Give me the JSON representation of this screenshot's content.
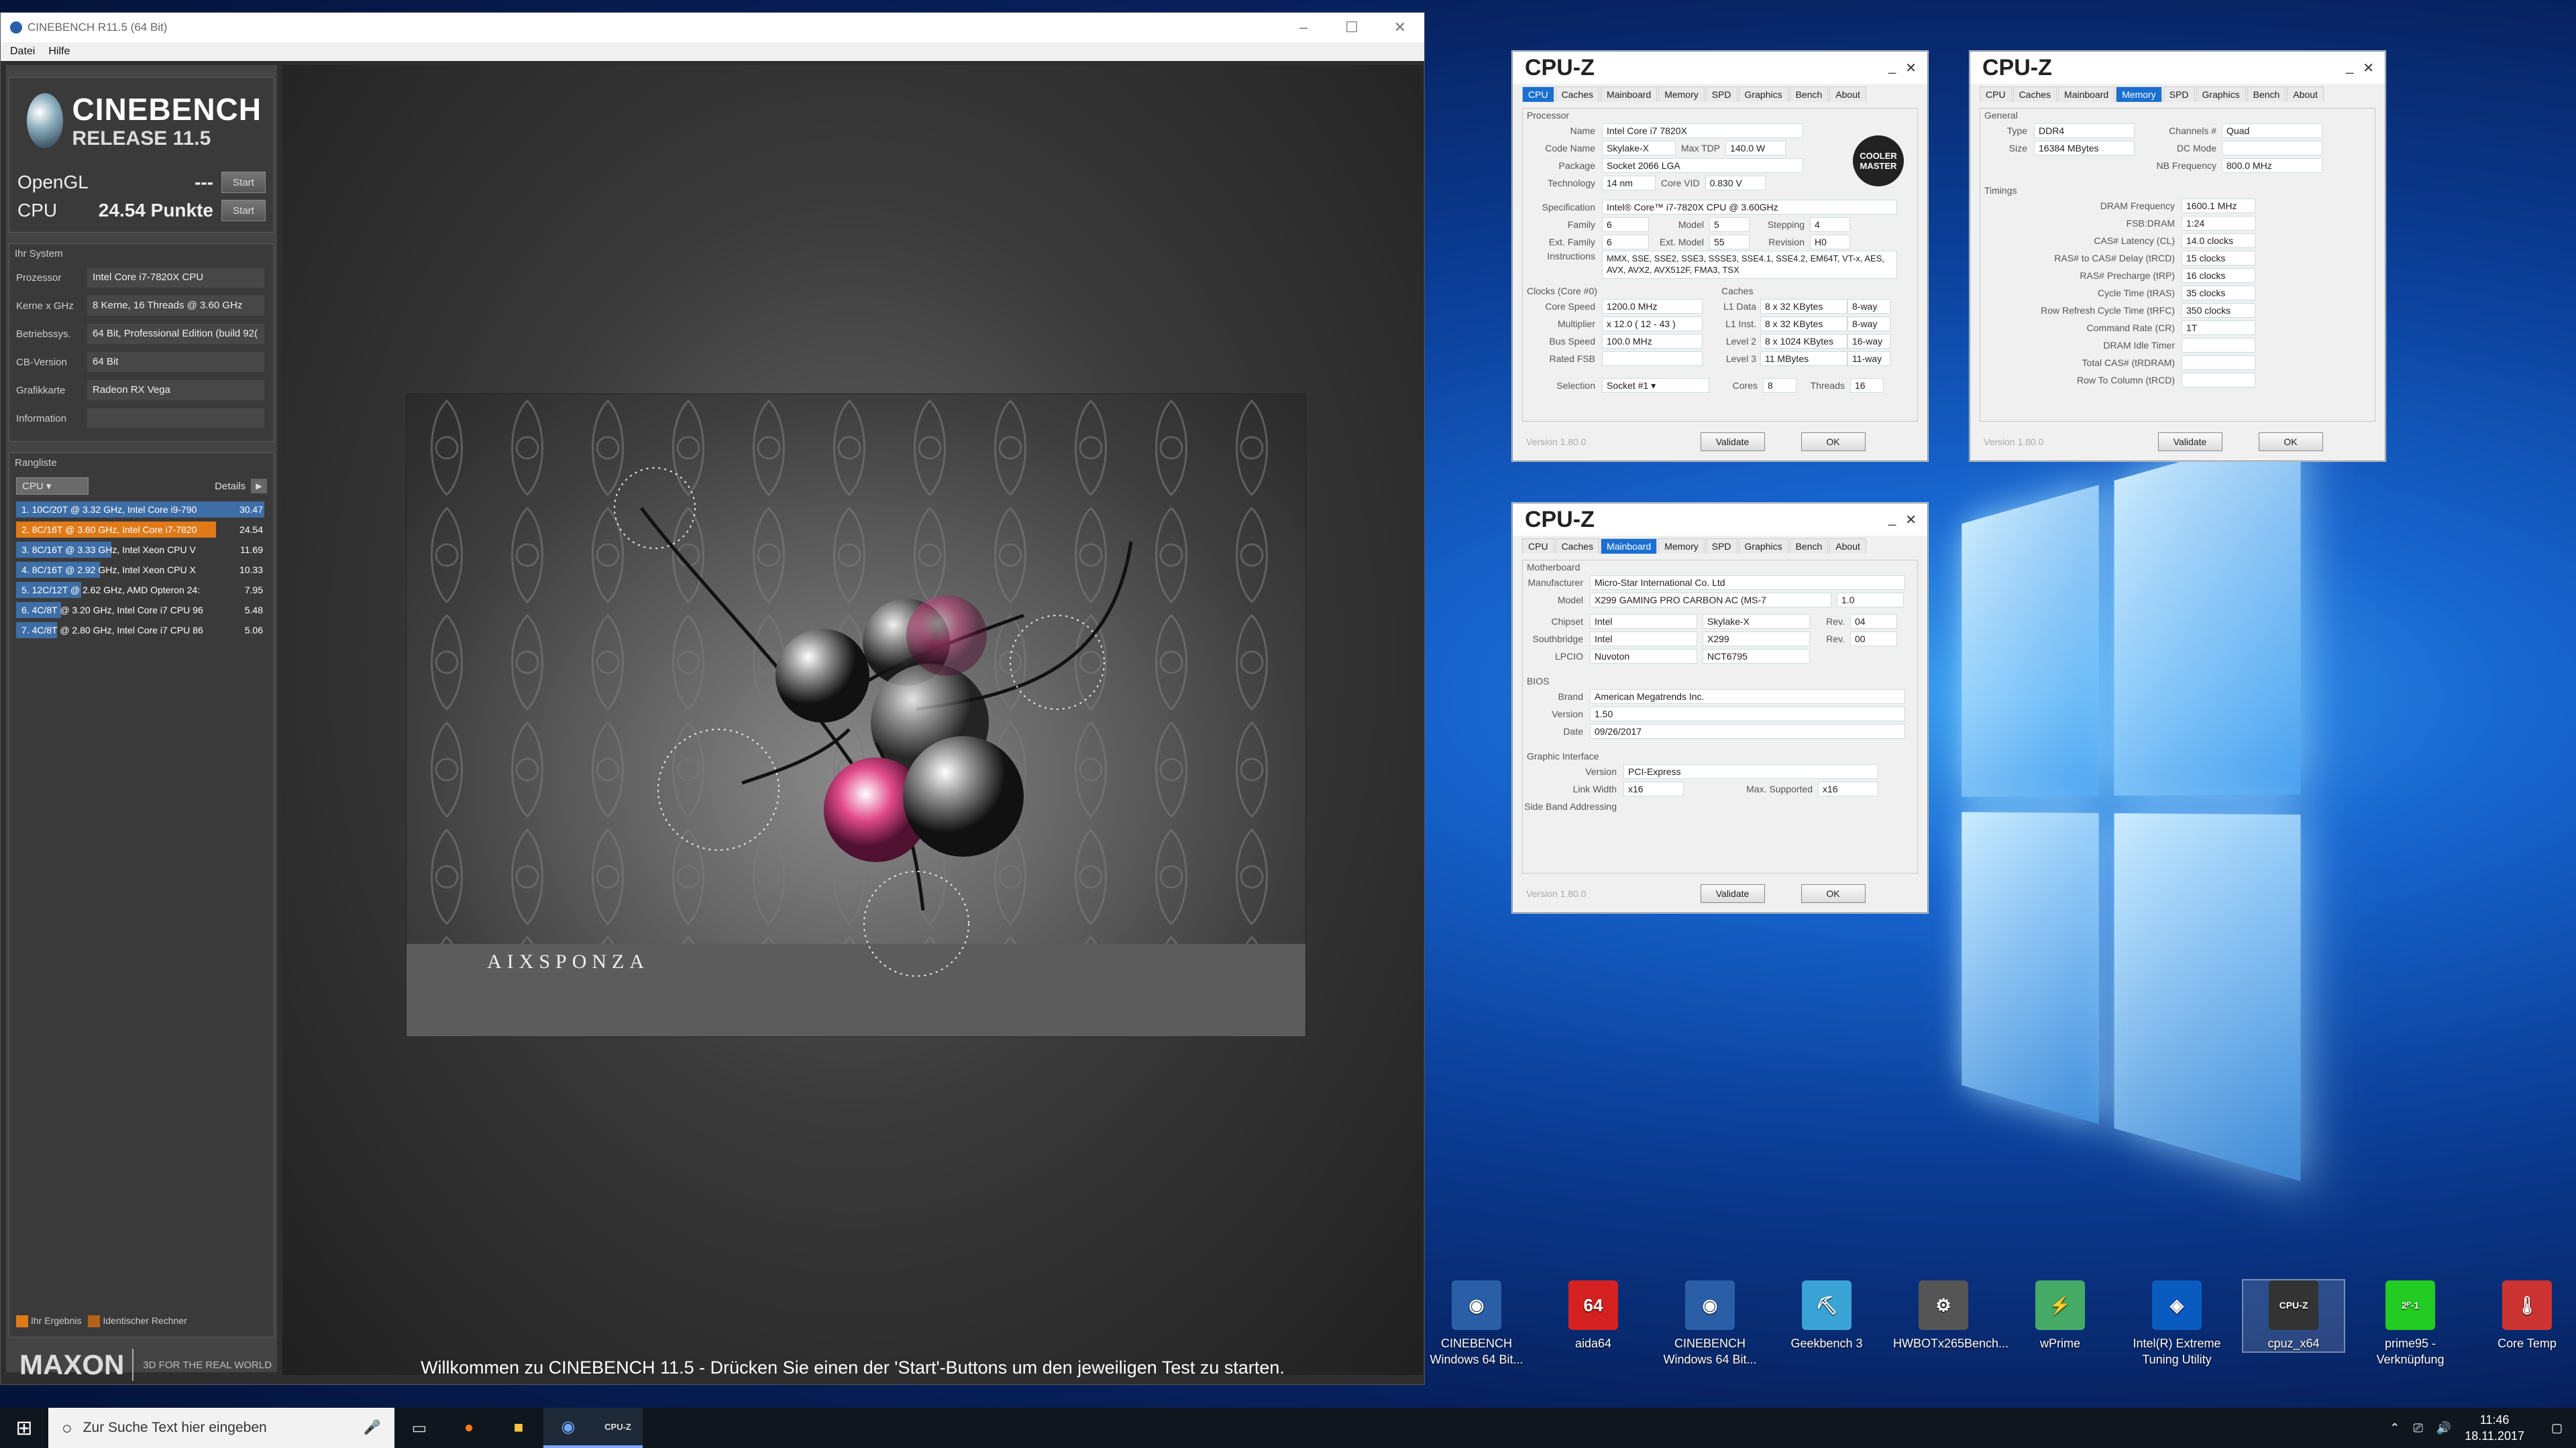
{
  "desktop_icons": [
    {
      "label": "CINEBENCH\nWindows 64 Bit...",
      "color": "#2a5fa8",
      "glyph": "◉"
    },
    {
      "label": "aida64",
      "color": "#d42020",
      "glyph": "64"
    },
    {
      "label": "CINEBENCH\nWindows 64 Bit...",
      "color": "#2a5fa8",
      "glyph": "◉"
    },
    {
      "label": "Geekbench 3",
      "color": "#3aa3d6",
      "glyph": "⛏"
    },
    {
      "label": "HWBOTx265Bench...",
      "color": "#555",
      "glyph": "⚙"
    },
    {
      "label": "wPrime",
      "color": "#4a6",
      "glyph": "⚡"
    },
    {
      "label": "Intel(R) Extreme\nTuning Utility",
      "color": "#0a5bc0",
      "glyph": "◈"
    },
    {
      "label": "cpuz_x64",
      "color": "#333",
      "glyph": "CPU-Z"
    },
    {
      "label": "prime95 -\nVerknüpfung",
      "color": "#2c2",
      "glyph": "2ᴾ-1"
    },
    {
      "label": "Core Temp",
      "color": "#c33",
      "glyph": "🌡"
    }
  ],
  "taskbar": {
    "search_placeholder": "Zur Suche Text hier eingeben",
    "time": "11:46",
    "date": "18.11.2017"
  },
  "cinebench": {
    "title": "CINEBENCH R11.5 (64 Bit)",
    "menu": [
      "Datei",
      "Hilfe"
    ],
    "logo_title": "CINEBENCH",
    "logo_sub": "RELEASE 11.5",
    "opengl_label": "OpenGL",
    "opengl_value": "---",
    "cpu_label": "CPU",
    "cpu_value": "24.54 Punkte",
    "start": "Start",
    "system_header": "Ihr System",
    "system": [
      {
        "k": "Prozessor",
        "v": "Intel Core i7-7820X CPU"
      },
      {
        "k": "Kerne x GHz",
        "v": "8 Kerne, 16 Threads @ 3.60 GHz"
      },
      {
        "k": "Betriebssys.",
        "v": "64 Bit, Professional Edition (build 92("
      },
      {
        "k": "CB-Version",
        "v": "64 Bit"
      },
      {
        "k": "Grafikkarte",
        "v": "Radeon RX Vega"
      },
      {
        "k": "Information",
        "v": ""
      }
    ],
    "rank_header": "Rangliste",
    "rank_select": "CPU",
    "details": "Details",
    "ranking": [
      {
        "label": "1. 10C/20T @ 3.32 GHz, Intel Core i9-790",
        "score": "30.47",
        "value": 30.47,
        "mine": false
      },
      {
        "label": "2. 8C/16T @ 3.60 GHz, Intel Core i7-7820",
        "score": "24.54",
        "value": 24.54,
        "mine": true
      },
      {
        "label": "3. 8C/16T @ 3.33 GHz, Intel Xeon CPU V",
        "score": "11.69",
        "value": 11.69,
        "mine": false
      },
      {
        "label": "4. 8C/16T @ 2.92 GHz, Intel Xeon CPU X",
        "score": "10.33",
        "value": 10.33,
        "mine": false
      },
      {
        "label": "5. 12C/12T @ 2.62 GHz, AMD Opteron 24:",
        "score": "7.95",
        "value": 7.95,
        "mine": false
      },
      {
        "label": "6. 4C/8T @ 3.20 GHz, Intel Core i7 CPU 96",
        "score": "5.48",
        "value": 5.48,
        "mine": false
      },
      {
        "label": "7. 4C/8T @ 2.80 GHz, Intel Core i7 CPU 86",
        "score": "5.06",
        "value": 5.06,
        "mine": false
      }
    ],
    "legend_mine": "Ihr Ergebnis",
    "legend_same": "Identischer Rechner",
    "maxon": "MAXON",
    "maxon_tag": "3D FOR THE REAL WORLD",
    "render_brand": "AIXSPONZA",
    "welcome": "Willkommen zu CINEBENCH 11.5 - Drücken Sie einen der 'Start'-Buttons um den jeweiligen Test zu starten."
  },
  "cpuz_title": "CPU-Z",
  "cpuz_tabs": [
    "CPU",
    "Caches",
    "Mainboard",
    "Memory",
    "SPD",
    "Graphics",
    "Bench",
    "About"
  ],
  "cpuz_version": "Version 1.80.0",
  "validate": "Validate",
  "ok": "OK",
  "maker_logo": "COOLER MASTER",
  "cpuz_cpu": {
    "processor": "Processor",
    "name": "Intel Core i7 7820X",
    "codename": "Skylake-X",
    "maxtdp": "140.0 W",
    "package": "Socket 2066 LGA",
    "technology": "14 nm",
    "corevid": "0.830 V",
    "spec": "Intel® Core™ i7-7820X CPU @ 3.60GHz",
    "family": "6",
    "model": "5",
    "stepping": "4",
    "extfamily": "6",
    "extmodel": "55",
    "revision": "H0",
    "instructions": "MMX, SSE, SSE2, SSE3, SSSE3, SSE4.1, SSE4.2, EM64T, VT-x, AES, AVX, AVX2, AVX512F, FMA3, TSX",
    "clocks": "Clocks (Core #0)",
    "caches": "Caches",
    "corespeed": "1200.0 MHz",
    "multiplier": "x 12.0 ( 12 - 43 )",
    "busspeed": "100.0 MHz",
    "ratedfsb": "",
    "l1d": "8 x 32 KBytes",
    "l1d_w": "8-way",
    "l1i": "8 x 32 KBytes",
    "l1i_w": "8-way",
    "l2": "8 x 1024 KBytes",
    "l2_w": "16-way",
    "l3": "11 MBytes",
    "l3_w": "11-way",
    "selection": "Socket #1",
    "cores": "8",
    "threads": "16"
  },
  "cpuz_mem": {
    "general": "General",
    "type": "DDR4",
    "channels": "Quad",
    "size": "16384 MBytes",
    "dcmode": "",
    "nbfreq": "800.0 MHz",
    "timings": "Timings",
    "rows": [
      {
        "k": "DRAM Frequency",
        "v": "1600.1 MHz"
      },
      {
        "k": "FSB:DRAM",
        "v": "1:24"
      },
      {
        "k": "CAS# Latency (CL)",
        "v": "14.0 clocks"
      },
      {
        "k": "RAS# to CAS# Delay (tRCD)",
        "v": "15 clocks"
      },
      {
        "k": "RAS# Precharge (tRP)",
        "v": "16 clocks"
      },
      {
        "k": "Cycle Time (tRAS)",
        "v": "35 clocks"
      },
      {
        "k": "Row Refresh Cycle Time (tRFC)",
        "v": "350 clocks"
      },
      {
        "k": "Command Rate (CR)",
        "v": "1T"
      },
      {
        "k": "DRAM Idle Timer",
        "v": ""
      },
      {
        "k": "Total CAS# (tRDRAM)",
        "v": ""
      },
      {
        "k": "Row To Column (tRCD)",
        "v": ""
      }
    ]
  },
  "cpuz_mb": {
    "motherboard": "Motherboard",
    "manufacturer": "Micro-Star International Co. Ltd",
    "model": "X299 GAMING PRO CARBON AC (MS-7",
    "model_rev": "1.0",
    "chipset": "Intel",
    "chipset2": "Skylake-X",
    "chipset_rev": "04",
    "south": "Intel",
    "south2": "X299",
    "south_rev": "00",
    "lpcio": "Nuvoton",
    "lpcio2": "NCT6795",
    "bios": "BIOS",
    "brand": "American Megatrends Inc.",
    "version": "1.50",
    "date": "09/26/2017",
    "gi": "Graphic Interface",
    "gi_version": "PCI-Express",
    "linkwidth": "x16",
    "maxsupported": "x16",
    "sideband": "Side Band Addressing"
  }
}
